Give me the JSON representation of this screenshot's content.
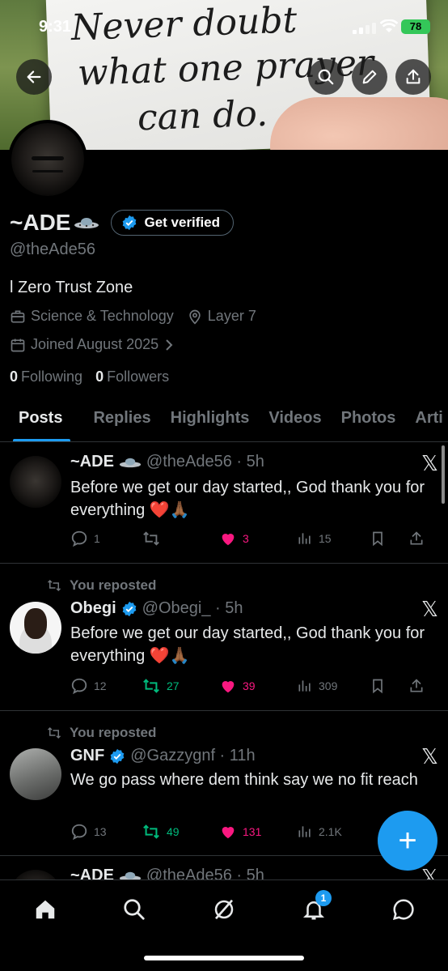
{
  "status_bar": {
    "time": "9:31",
    "battery": "78"
  },
  "banner": {
    "lines": [
      "Never doubt",
      "what one prayer",
      "can do."
    ]
  },
  "profile": {
    "display_name": "~ADE",
    "verify_label": "Get verified",
    "handle": "@theAde56",
    "bio": "l Zero Trust Zone",
    "category": "Science & Technology",
    "location": "Layer 7",
    "joined": "Joined August 2025",
    "following_count": "0",
    "following_label": "Following",
    "followers_count": "0",
    "followers_label": "Followers"
  },
  "tabs": [
    "Posts",
    "Replies",
    "Highlights",
    "Videos",
    "Photos",
    "Arti"
  ],
  "posts": [
    {
      "reposted": "",
      "name": "~ADE",
      "sub": "@theAde56 · 5h",
      "text": "Before we get our day started,, God thank you for everything ❤️🙏🏾",
      "replies": "1",
      "reposts": "",
      "likes": "3",
      "views": "15"
    },
    {
      "reposted": "You reposted",
      "name": "Obegi",
      "sub": "@Obegi_ · 5h",
      "text": "Before we get our day started,, God thank you for everything ❤️🙏🏾",
      "replies": "12",
      "reposts": "27",
      "likes": "39",
      "views": "309"
    },
    {
      "reposted": "You reposted",
      "name": "GNF",
      "sub": "@Gazzygnf · 11h",
      "text": "We go pass where dem think say we no fit reach",
      "replies": "13",
      "reposts": "49",
      "likes": "131",
      "views": "2.1K"
    },
    {
      "reposted": "",
      "name": "~ADE",
      "sub": "@theAde56 · 5h",
      "text": "",
      "replies": "",
      "reposts": "",
      "likes": "",
      "views": ""
    }
  ],
  "notifications_badge": "1",
  "colors": {
    "accent": "#1d9bf0",
    "like": "#f91880",
    "repost": "#00ba7c",
    "muted": "#71767b"
  }
}
